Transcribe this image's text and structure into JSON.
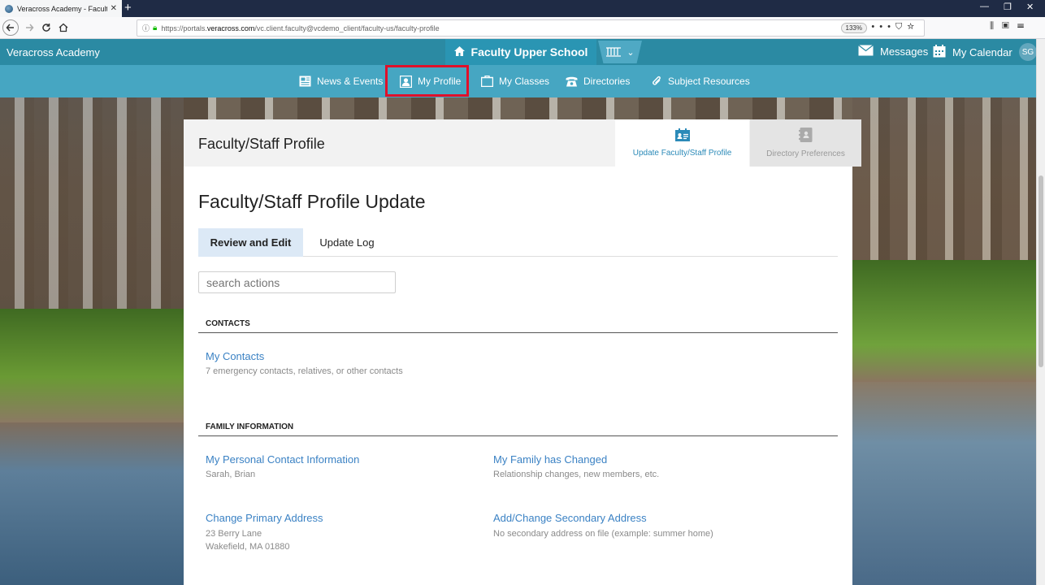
{
  "browser": {
    "tab_title": "Veracross Academy - Faculty U",
    "new_tab": "+",
    "url_prefix": "https://portals.",
    "url_domain": "veracross.com",
    "url_path": "/vc.client.faculty@vcdemo_client/faculty-us/faculty-profile",
    "zoom": "133%"
  },
  "header": {
    "brand": "Veracross Academy",
    "school": "Faculty Upper School",
    "messages": "Messages",
    "calendar": "My Calendar",
    "avatar": "SG"
  },
  "subnav": {
    "items": [
      {
        "label": "News & Events",
        "icon": "newspaper-icon"
      },
      {
        "label": "My Profile",
        "icon": "profile-icon"
      },
      {
        "label": "My Classes",
        "icon": "classes-icon"
      },
      {
        "label": "Directories",
        "icon": "phone-icon"
      },
      {
        "label": "Subject Resources",
        "icon": "paperclip-icon"
      }
    ],
    "highlight_color": "#e0102a"
  },
  "panel": {
    "title": "Faculty/Staff Profile",
    "tab_update": "Update Faculty/Staff Profile",
    "tab_directory": "Directory Preferences"
  },
  "content": {
    "page_title": "Faculty/Staff Profile Update",
    "tab_review": "Review and Edit",
    "tab_log": "Update Log",
    "search_placeholder": "search actions",
    "contacts": {
      "heading": "CONTACTS",
      "my_contacts": "My Contacts",
      "my_contacts_desc": "7 emergency contacts, relatives, or other contacts"
    },
    "family": {
      "heading": "FAMILY INFORMATION",
      "personal": "My Personal Contact Information",
      "personal_desc": "Sarah, Brian",
      "changed": "My Family has Changed",
      "changed_desc": "Relationship changes, new members, etc.",
      "primary": "Change Primary Address",
      "primary_line1": "23 Berry Lane",
      "primary_line2": "Wakefield, MA 01880",
      "secondary": "Add/Change Secondary Address",
      "secondary_desc": "No secondary address on file (example: summer home)"
    }
  },
  "colors": {
    "header": "#2b8aa3",
    "subnav": "#46a6c2",
    "link": "#3b82c4"
  }
}
